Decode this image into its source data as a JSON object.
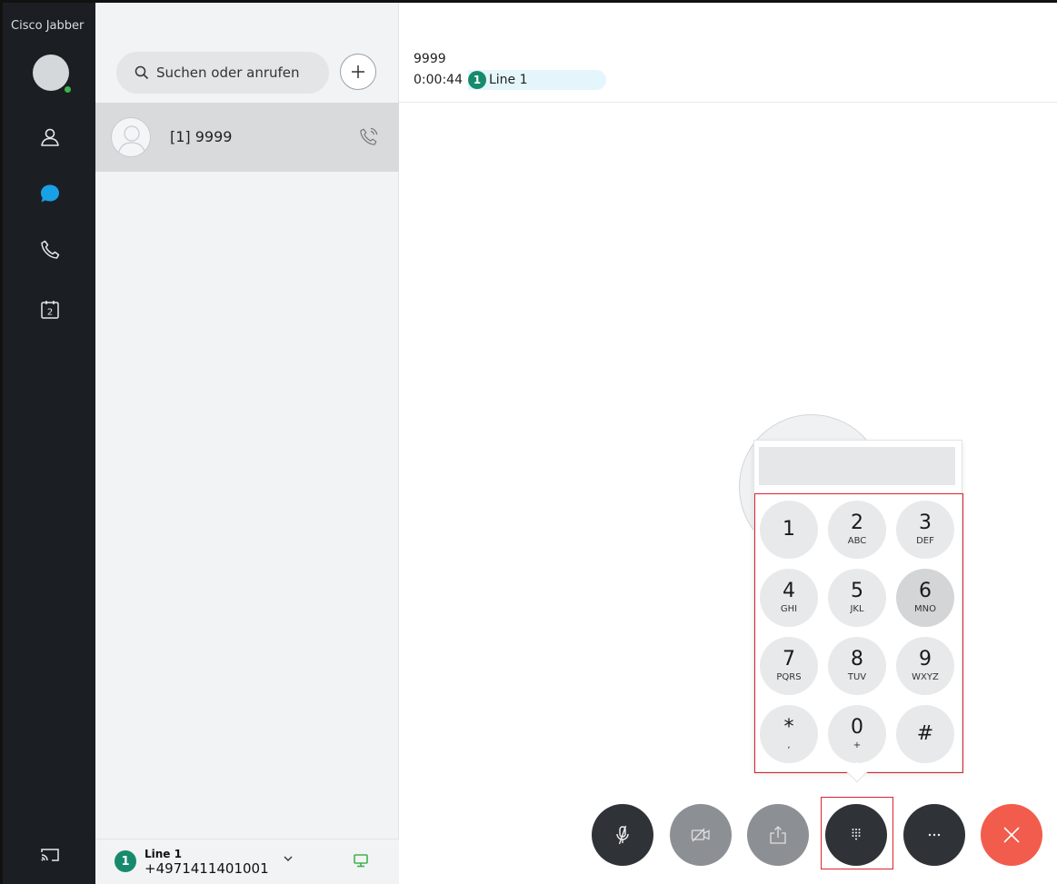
{
  "app": {
    "title": "Cisco Jabber"
  },
  "rail": {
    "items": [
      {
        "name": "contacts",
        "icon": "person-icon"
      },
      {
        "name": "chats",
        "icon": "chat-bubble-icon"
      },
      {
        "name": "calls",
        "icon": "phone-icon"
      },
      {
        "name": "meetings",
        "icon": "calendar-icon",
        "badge": "2"
      }
    ],
    "bottom_icon": "cast-screen-icon"
  },
  "search": {
    "placeholder": "Suchen oder anrufen"
  },
  "contacts": [
    {
      "label": "[1] 9999"
    }
  ],
  "line": {
    "badge": "1",
    "name": "Line 1",
    "number": "+4971411401001"
  },
  "call": {
    "name": "9999",
    "timer": "0:00:44",
    "line_badge": "1",
    "line_label": "Line 1"
  },
  "keypad": {
    "display_value": "",
    "keys": [
      {
        "digit": "1",
        "letters": ""
      },
      {
        "digit": "2",
        "letters": "ABC"
      },
      {
        "digit": "3",
        "letters": "DEF"
      },
      {
        "digit": "4",
        "letters": "GHI"
      },
      {
        "digit": "5",
        "letters": "JKL"
      },
      {
        "digit": "6",
        "letters": "MNO"
      },
      {
        "digit": "7",
        "letters": "PQRS"
      },
      {
        "digit": "8",
        "letters": "TUV"
      },
      {
        "digit": "9",
        "letters": "WXYZ"
      },
      {
        "digit": "*",
        "letters": ","
      },
      {
        "digit": "0",
        "letters": "+"
      },
      {
        "digit": "#",
        "letters": ""
      }
    ],
    "active_key": "6"
  },
  "controls": {
    "mute_icon": "microphone-muted-icon",
    "video_icon": "video-off-icon",
    "share_icon": "share-screen-icon",
    "keypad_icon": "keypad-icon",
    "more_icon": "more-icon",
    "end_icon": "end-call-icon"
  },
  "colors": {
    "accent_green": "#178a6d",
    "presence_green": "#3fb34f",
    "chat_blue": "#1aa0e6",
    "end_call_red": "#f25c4c",
    "highlight_red": "#d9252e"
  }
}
